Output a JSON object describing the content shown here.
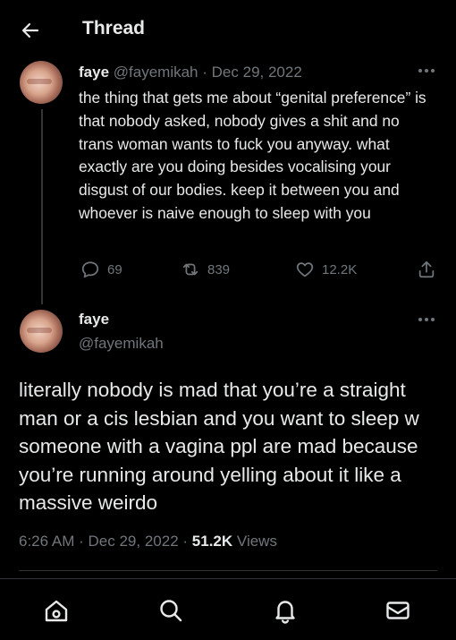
{
  "header": {
    "title": "Thread",
    "back_icon": "arrow-left-icon"
  },
  "reply_post": {
    "author_name": "faye",
    "handle": "@fayemikah",
    "separator": "·",
    "date": "Dec 29, 2022",
    "text": "the thing that gets me about “genital preference” is that nobody asked, nobody gives a shit and no trans woman wants to fuck you anyway. what exactly are you doing besides vocalising your disgust of our bodies. keep it between you and whoever is naive enough to sleep with you",
    "stats": {
      "replies": "69",
      "reposts": "839",
      "likes": "12.2K"
    }
  },
  "main_post": {
    "author_name": "faye",
    "handle": "@fayemikah",
    "text": "literally nobody is mad that you’re a straight man or a cis lesbian and you want to sleep w someone with a vagina  ppl are mad because you’re running around yelling about it like a massive weirdo",
    "time": "6:26 AM",
    "separator": "·",
    "date": "Dec 29, 2022",
    "views_count": "51.2K",
    "views_label": "Views"
  },
  "nav": [
    "home-icon",
    "search-icon",
    "notifications-bell-icon",
    "messages-envelope-icon"
  ],
  "colors": {
    "background": "#000000",
    "text": "#e7e9ea",
    "muted": "#71767b",
    "divider": "#2f3336"
  }
}
